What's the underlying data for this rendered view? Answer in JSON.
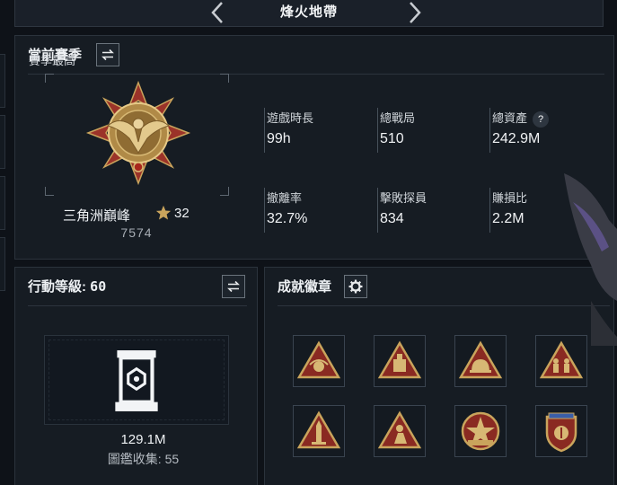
{
  "header": {
    "title": "烽火地帶"
  },
  "season": {
    "heading": "當前賽季",
    "subheading": "賽季最高",
    "rank_name": "三角洲巔峰",
    "rank_level": "32",
    "rank_points": "7574",
    "stats": [
      {
        "label": "遊戲時長",
        "value": "99h"
      },
      {
        "label": "總戰局",
        "value": "510"
      },
      {
        "label": "總資產",
        "value": "242.9M",
        "help": "?"
      },
      {
        "label": "撤離率",
        "value": "32.7%"
      },
      {
        "label": "擊敗探員",
        "value": "834"
      },
      {
        "label": "賺損比",
        "value": "2.2M"
      }
    ]
  },
  "action_level": {
    "heading": "行動等級: ",
    "level": "60",
    "value": "129.1M",
    "collection": "圖鑑收集: 55"
  },
  "achievements": {
    "heading": "成就徽章",
    "badges": [
      {
        "icon": "triangle-badge-emblem"
      },
      {
        "icon": "triangle-badge-crate"
      },
      {
        "icon": "triangle-badge-helmet"
      },
      {
        "icon": "triangle-badge-soldiers"
      },
      {
        "icon": "triangle-badge-rocket"
      },
      {
        "icon": "triangle-badge-runner"
      },
      {
        "icon": "star-medal-badge"
      },
      {
        "icon": "shield-badge"
      }
    ]
  },
  "colors": {
    "background": "#0e1218",
    "panel": "#161c23",
    "gold": "#c9a45c",
    "badge_red": "#8a2a22"
  }
}
